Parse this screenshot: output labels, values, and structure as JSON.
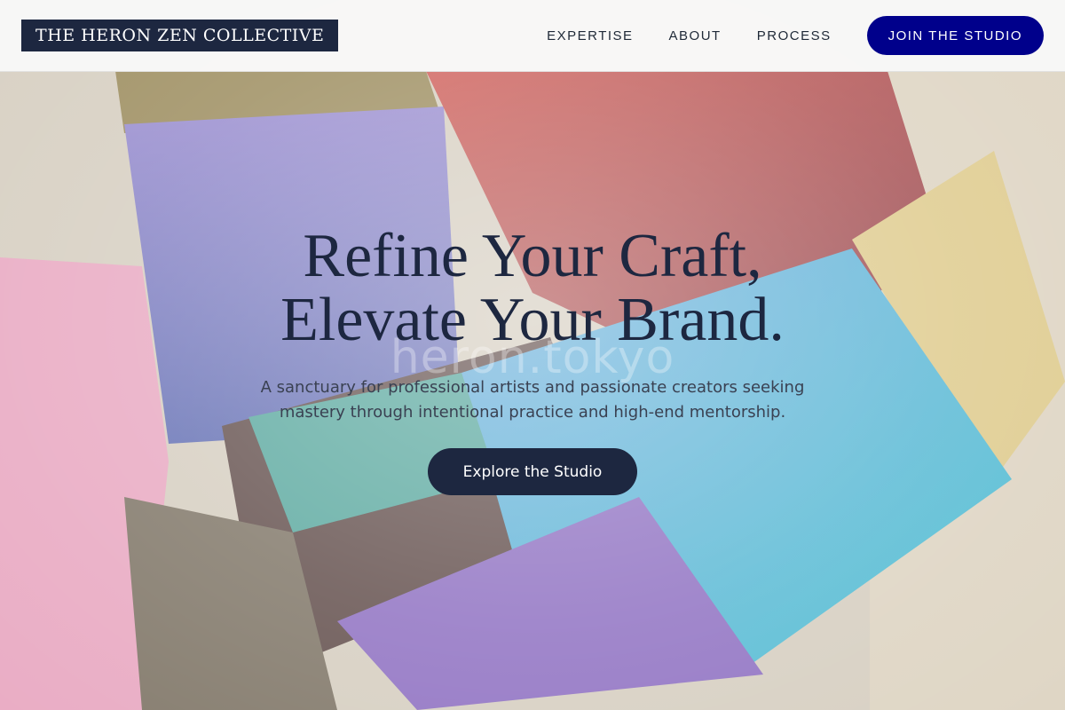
{
  "header": {
    "logo_text": "THE HERON ZEN COLLECTIVE",
    "nav": [
      {
        "label": "EXPERTISE"
      },
      {
        "label": "ABOUT"
      },
      {
        "label": "PROCESS"
      }
    ],
    "cta_label": "JOIN THE STUDIO"
  },
  "hero": {
    "headline_line1": "Refine Your Craft,",
    "headline_line2": "Elevate Your Brand.",
    "watermark": "heron.tokyo",
    "subtitle": "A sanctuary for professional artists and passionate creators seeking mastery through intentional practice and high-end mentorship.",
    "cta_label": "Explore the Studio",
    "background_image": "paint-brushes-photo"
  },
  "colors": {
    "navy": "#1d2740",
    "button_blue": "#00008b",
    "header_bg": "#fafafa"
  }
}
